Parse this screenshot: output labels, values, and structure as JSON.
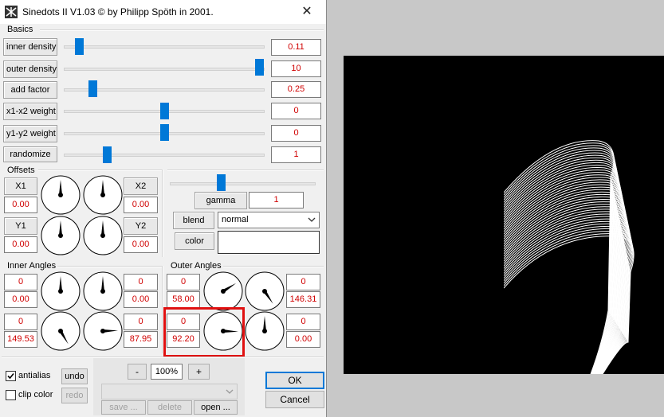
{
  "window": {
    "title": "Sinedots II V1.03 © by Philipp Spöth in 2001.",
    "close_glyph": "✕"
  },
  "basics": {
    "label": "Basics",
    "rows": [
      {
        "label": "inner density",
        "value": "0.11"
      },
      {
        "label": "outer density",
        "value": "10"
      },
      {
        "label": "add factor",
        "value": "0.25"
      },
      {
        "label": "x1-x2 weight",
        "value": "0"
      },
      {
        "label": "y1-y2 weight",
        "value": "0"
      },
      {
        "label": "randomize",
        "value": "1"
      }
    ]
  },
  "offsets": {
    "label": "Offsets",
    "x1": {
      "label": "X1",
      "value": "0.00"
    },
    "x2": {
      "label": "X2",
      "value": "0.00"
    },
    "y1": {
      "label": "Y1",
      "value": "0.00"
    },
    "y2": {
      "label": "Y2",
      "value": "0.00"
    }
  },
  "render": {
    "gamma_label": "gamma",
    "gamma_value": "1",
    "blend_label": "blend",
    "blend_value": "normal",
    "color_label": "color",
    "color_swatch": "#ffffff"
  },
  "inner_angles": {
    "label": "Inner Angles",
    "top_left": {
      "a": "0",
      "b": "0.00"
    },
    "top_right": {
      "a": "0",
      "b": "0.00"
    },
    "bottom_left": {
      "a": "0",
      "b": "149.53"
    },
    "bottom_right": {
      "a": "0",
      "b": "87.95"
    }
  },
  "outer_angles": {
    "label": "Outer Angles",
    "top_left": {
      "a": "0",
      "b": "58.00"
    },
    "top_right": {
      "a": "0",
      "b": "146.31"
    },
    "bottom_left": {
      "a": "0",
      "b": "92.20"
    },
    "bottom_right": {
      "a": "0",
      "b": "0.00"
    }
  },
  "bottom": {
    "antialias_label": "antialias",
    "antialias_checked": true,
    "clip_color_label": "clip color",
    "clip_color_checked": false,
    "undo_label": "undo",
    "redo_label": "redo",
    "zoom_minus": "-",
    "zoom_value": "100%",
    "zoom_plus": "+",
    "save_label": "save ...",
    "delete_label": "delete",
    "open_label": "open ...",
    "ok_label": "OK",
    "cancel_label": "Cancel"
  },
  "colors": {
    "accent": "#0078d7",
    "value_text": "#d00000",
    "highlight": "#e01010",
    "preview_bg": "#000000"
  }
}
